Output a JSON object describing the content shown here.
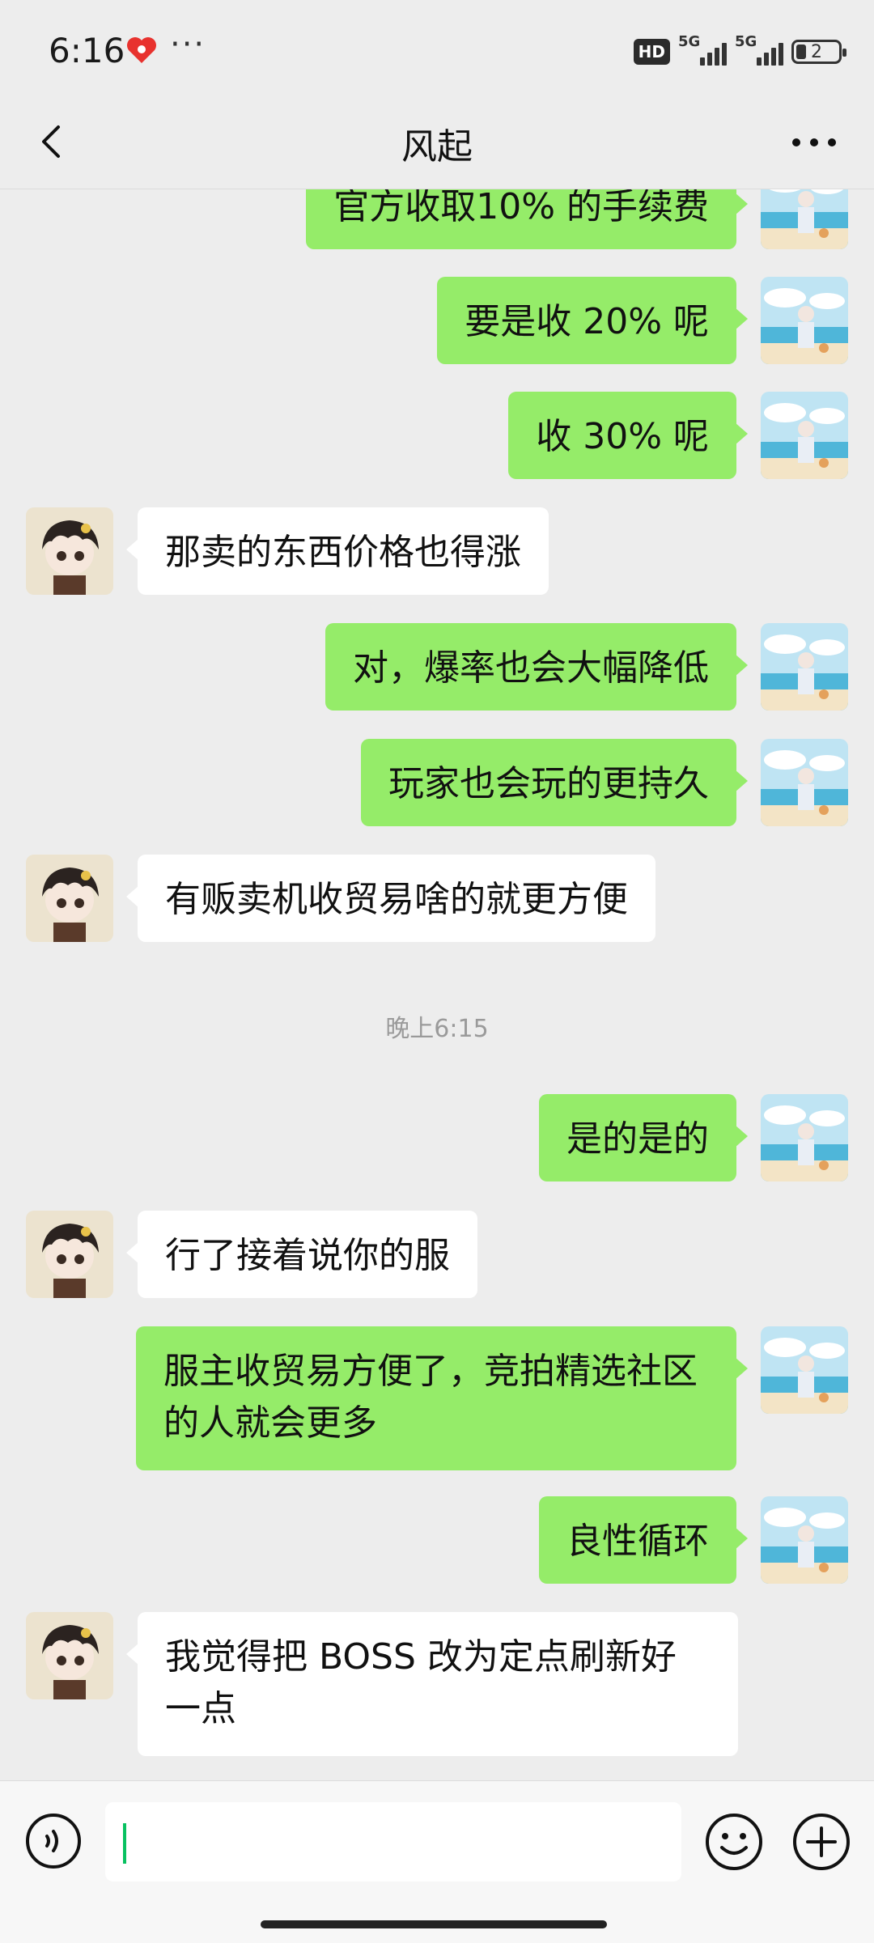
{
  "status_bar": {
    "time": "6:16",
    "more": "···",
    "hd_label": "HD",
    "sim1_label": "5G",
    "sim2_label": "5G",
    "battery_level": "2"
  },
  "header": {
    "title": "风起"
  },
  "messages": [
    {
      "sender": "me",
      "text": "官方收取10% 的手续费"
    },
    {
      "sender": "me",
      "text": "要是收 20% 呢"
    },
    {
      "sender": "me",
      "text": "收 30% 呢"
    },
    {
      "sender": "other",
      "text": "那卖的东西价格也得涨"
    },
    {
      "sender": "me",
      "text": "对，爆率也会大幅降低"
    },
    {
      "sender": "me",
      "text": "玩家也会玩的更持久"
    },
    {
      "sender": "other",
      "text": "有贩卖机收贸易啥的就更方便"
    },
    {
      "sender": "me",
      "text": "是的是的"
    },
    {
      "sender": "other",
      "text": "行了接着说你的服"
    },
    {
      "sender": "me",
      "text": "服主收贸易方便了，竞拍精选社区的人就会更多"
    },
    {
      "sender": "me",
      "text": "良性循环"
    },
    {
      "sender": "other",
      "text": "我觉得把 BOSS 改为定点刷新好一点"
    }
  ],
  "timestamp": "晚上6:15",
  "input": {
    "value": "",
    "placeholder": ""
  },
  "icons": {
    "back": "back-arrow-icon",
    "more": "more-dots-icon",
    "voice": "voice-icon",
    "emoji": "emoji-icon",
    "plus": "plus-icon"
  },
  "colors": {
    "my_bubble": "#95ec69",
    "their_bubble": "#ffffff",
    "background": "#ededed",
    "caret": "#07c160"
  }
}
